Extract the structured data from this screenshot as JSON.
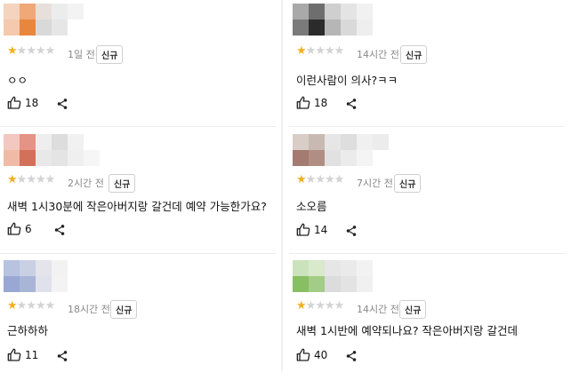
{
  "colors": {
    "star_on": "#f2b01e",
    "star_off": "#d3d3d3"
  },
  "comments": [
    {
      "id": "c1",
      "time": "1일 전",
      "badge": "신규",
      "rating": 1,
      "text": "ㅇㅇ",
      "likes": "18",
      "mosaic": [
        "#f4d3bf",
        "#f0a877",
        "#e7e0da",
        "#ececec",
        "#f3f3f3",
        "#ffffff",
        "#f4c9ad",
        "#e8863e",
        "#d9d9d9",
        "#e6e6e6",
        "#ffffff",
        "#ffffff"
      ]
    },
    {
      "id": "c2",
      "time": "14시간 전",
      "badge": "신규",
      "rating": 1,
      "text": "이런사람이 의사?ㅋㅋ",
      "likes": "18",
      "mosaic": [
        "#a9a9a9",
        "#6e6e6e",
        "#cfcfcf",
        "#e4e4e4",
        "#f1f1f1",
        "#ffffff",
        "#7a7a7a",
        "#2b2b2b",
        "#b6b6b6",
        "#d9d9d9",
        "#eeeeee",
        "#ffffff"
      ]
    },
    {
      "id": "c3",
      "time": "2시간 전",
      "badge": "신규",
      "rating": 1,
      "text": "새벽 1시30분에 작은아버지랑 갈건데 예약 가능한가요?",
      "likes": "6",
      "mosaic": [
        "#f3c8c0",
        "#e49384",
        "#eeeeee",
        "#dddddd",
        "#f1f1f1",
        "#ffffff",
        "#f0bba6",
        "#d3705a",
        "#e8e8e8",
        "#e4e4e4",
        "#efefef",
        "#f6f6f6"
      ]
    },
    {
      "id": "c4",
      "time": "7시간 전",
      "badge": "신규",
      "rating": 1,
      "text": "소오름",
      "likes": "14",
      "mosaic": [
        "#d9cdc8",
        "#c8b9b2",
        "#e6e6e6",
        "#dedede",
        "#f0f0f0",
        "#ececec",
        "#a47b70",
        "#b08e84",
        "#e1e1e1",
        "#ebebeb",
        "#f4f4f4",
        "#ffffff"
      ]
    },
    {
      "id": "c5",
      "time": "18시간 전",
      "badge": "신규",
      "rating": 1,
      "text": "근하하하",
      "likes": "11",
      "mosaic": [
        "#b8c3e0",
        "#c9d0e4",
        "#e4e4ea",
        "#f2f2f2",
        "#ffffff",
        "#ffffff",
        "#98a7d3",
        "#a9b5d6",
        "#dfe2ea",
        "#f3f3f3",
        "#ffffff",
        "#ffffff"
      ]
    },
    {
      "id": "c6",
      "time": "14시간 전",
      "badge": "신규",
      "rating": 1,
      "text": "새벽 1시반에 예약되나요? 작은아버지랑 갈건데",
      "likes": "40",
      "mosaic": [
        "#cbe3bd",
        "#d9e9cc",
        "#e6e6e6",
        "#eaeaea",
        "#f2f2f2",
        "#ffffff",
        "#87bf62",
        "#a3cd86",
        "#dcdcdc",
        "#e3e3e3",
        "#f0f0f0",
        "#ffffff"
      ]
    }
  ]
}
